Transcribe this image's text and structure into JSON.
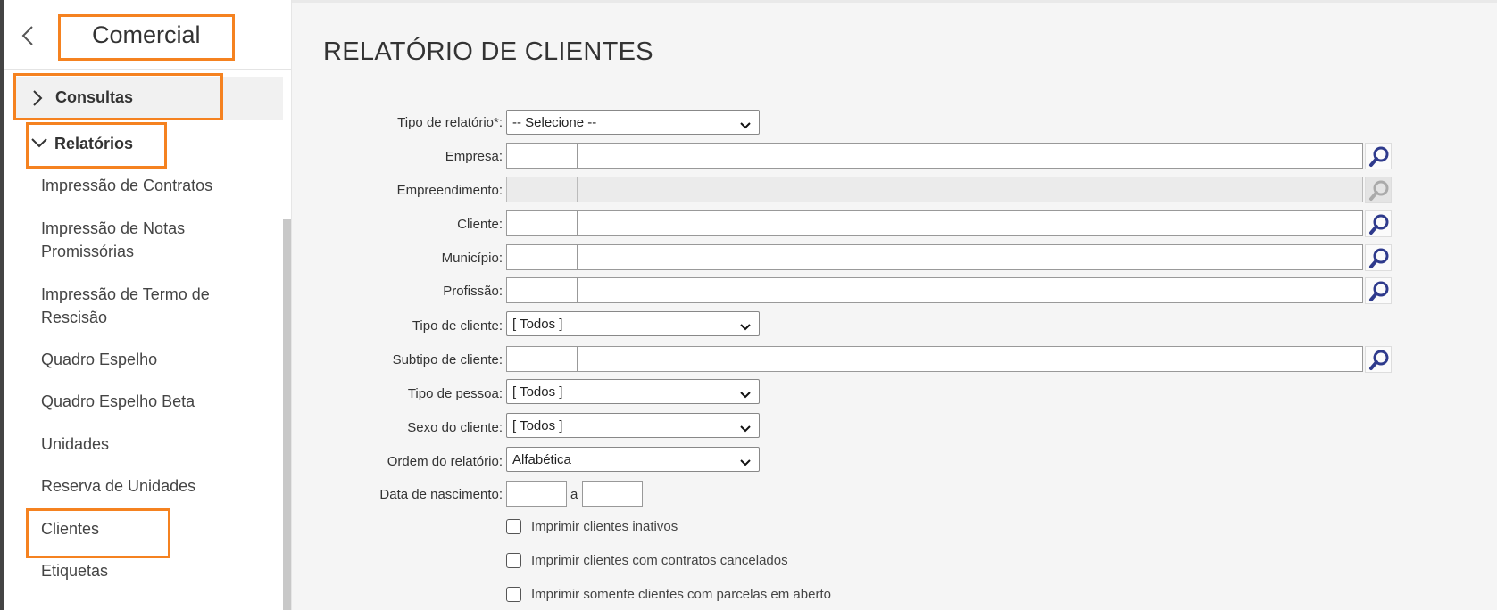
{
  "sidebar": {
    "title": "Comercial",
    "back_icon": "chevron-left-icon",
    "sections": {
      "consultas": "Consultas",
      "relatorios": "Relatórios"
    },
    "items": [
      "Impressão de Contratos",
      "Impressão de Notas Promissórias",
      "Impressão de Termo de Rescisão",
      "Quadro Espelho",
      "Quadro Espelho Beta",
      "Unidades",
      "Reserva de Unidades",
      "Clientes",
      "Etiquetas"
    ],
    "highlight_color": "#f58220"
  },
  "main": {
    "title": "RELATÓRIO DE CLIENTES",
    "labels": {
      "tipo_relatorio": "Tipo de relatório*:",
      "empresa": "Empresa:",
      "empreendimento": "Empreendimento:",
      "cliente": "Cliente:",
      "municipio": "Município:",
      "profissao": "Profissão:",
      "tipo_cliente": "Tipo de cliente:",
      "subtipo_cliente": "Subtipo de cliente:",
      "tipo_pessoa": "Tipo de pessoa:",
      "sexo_cliente": "Sexo do cliente:",
      "ordem_relatorio": "Ordem do relatório:",
      "data_nascimento": "Data de nascimento:"
    },
    "selects": {
      "tipo_relatorio": "-- Selecione --",
      "tipo_cliente": "[ Todos ]",
      "tipo_pessoa": "[ Todos ]",
      "sexo_cliente": "[ Todos ]",
      "ordem_relatorio": "Alfabética"
    },
    "date_separator": "a",
    "checkboxes": [
      "Imprimir clientes inativos",
      "Imprimir clientes com contratos cancelados",
      "Imprimir somente clientes com parcelas em aberto"
    ],
    "search_icon": "magnifier-icon",
    "accent_color": "#2e3a8c"
  }
}
